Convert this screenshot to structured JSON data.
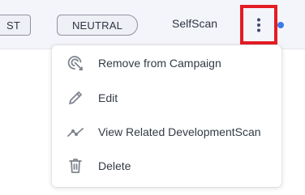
{
  "row": {
    "left_pill_text": "ST",
    "status_pill": "NEUTRAL",
    "source": "SelfScan",
    "indicator_color": "#3d7be5"
  },
  "actions_button": {
    "icon": "vertical-ellipsis-icon",
    "highlight_color": "#e51c23"
  },
  "menu": {
    "items": [
      {
        "label": "Remove from Campaign",
        "icon": "remove-campaign-icon"
      },
      {
        "label": "Edit",
        "icon": "pencil-icon"
      },
      {
        "label": "View Related DevelopmentScan",
        "icon": "trend-line-icon"
      },
      {
        "label": "Delete",
        "icon": "trash-icon"
      }
    ]
  }
}
